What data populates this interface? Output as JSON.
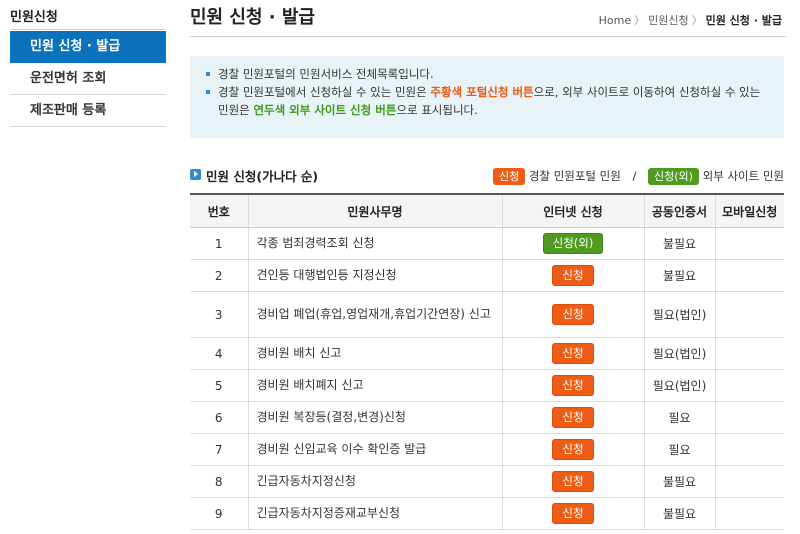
{
  "sidebar": {
    "title": "민원신청",
    "items": [
      {
        "label": "민원 신청 · 발급",
        "active": true
      },
      {
        "label": "운전면허 조회",
        "active": false
      },
      {
        "label": "제조판매 등록",
        "active": false
      }
    ]
  },
  "header": {
    "title": "민원 신청 · 발급",
    "breadcrumb": [
      "Home",
      "민원신청",
      "민원 신청 · 발급"
    ]
  },
  "notice": {
    "line1": "경찰 민원포털의 민원서비스 전체목록입니다.",
    "line2_a": "경찰 민원포털에서 신청하실 수 있는 민원은 ",
    "line2_b": "주황색 포털신청 버튼",
    "line2_c": "으로, 외부 사이트로 이동하여 신청하실 수 있는",
    "line2_d": "민원은 ",
    "line2_e": "연두색 외부 사이트 신청 버튼",
    "line2_f": "으로 표시됩니다."
  },
  "section": {
    "title": "민원 신청(가나다 순)",
    "legend_portal_badge": "신청",
    "legend_portal_label": "경찰 민원포털 민원",
    "legend_slash": "/",
    "legend_ext_badge": "신청(외)",
    "legend_ext_label": "외부 사이트 민원"
  },
  "colors": {
    "accent": "#0b72bd",
    "portal_button": "#ee5d16",
    "external_button": "#4f9b1f"
  },
  "table": {
    "headers": [
      "번호",
      "민원사무명",
      "인터넷 신청",
      "공동인증서",
      "모바일신청"
    ],
    "rows": [
      {
        "no": "1",
        "name": "각종 범죄경력조회 신청",
        "apply": "신청(외)",
        "type": "external",
        "cert": "불필요",
        "mobile": ""
      },
      {
        "no": "2",
        "name": "견인등 대행법인등 지정신청",
        "apply": "신청",
        "type": "portal",
        "cert": "불필요",
        "mobile": ""
      },
      {
        "no": "3",
        "name": "경비업 폐업(휴업,영업재개,휴업기간연장) 신고",
        "apply": "신청",
        "type": "portal",
        "cert": "필요(법인)",
        "mobile": ""
      },
      {
        "no": "4",
        "name": "경비원 배치 신고",
        "apply": "신청",
        "type": "portal",
        "cert": "필요(법인)",
        "mobile": ""
      },
      {
        "no": "5",
        "name": "경비원 배치폐지 신고",
        "apply": "신청",
        "type": "portal",
        "cert": "필요(법인)",
        "mobile": ""
      },
      {
        "no": "6",
        "name": "경비원 복장등(결정,변경)신청",
        "apply": "신청",
        "type": "portal",
        "cert": "필요",
        "mobile": ""
      },
      {
        "no": "7",
        "name": "경비원 신임교육 이수 확인증 발급",
        "apply": "신청",
        "type": "portal",
        "cert": "필요",
        "mobile": ""
      },
      {
        "no": "8",
        "name": "긴급자동차지정신청",
        "apply": "신청",
        "type": "portal",
        "cert": "불필요",
        "mobile": ""
      },
      {
        "no": "9",
        "name": "긴급자동차지정증재교부신청",
        "apply": "신청",
        "type": "portal",
        "cert": "불필요",
        "mobile": ""
      }
    ]
  }
}
